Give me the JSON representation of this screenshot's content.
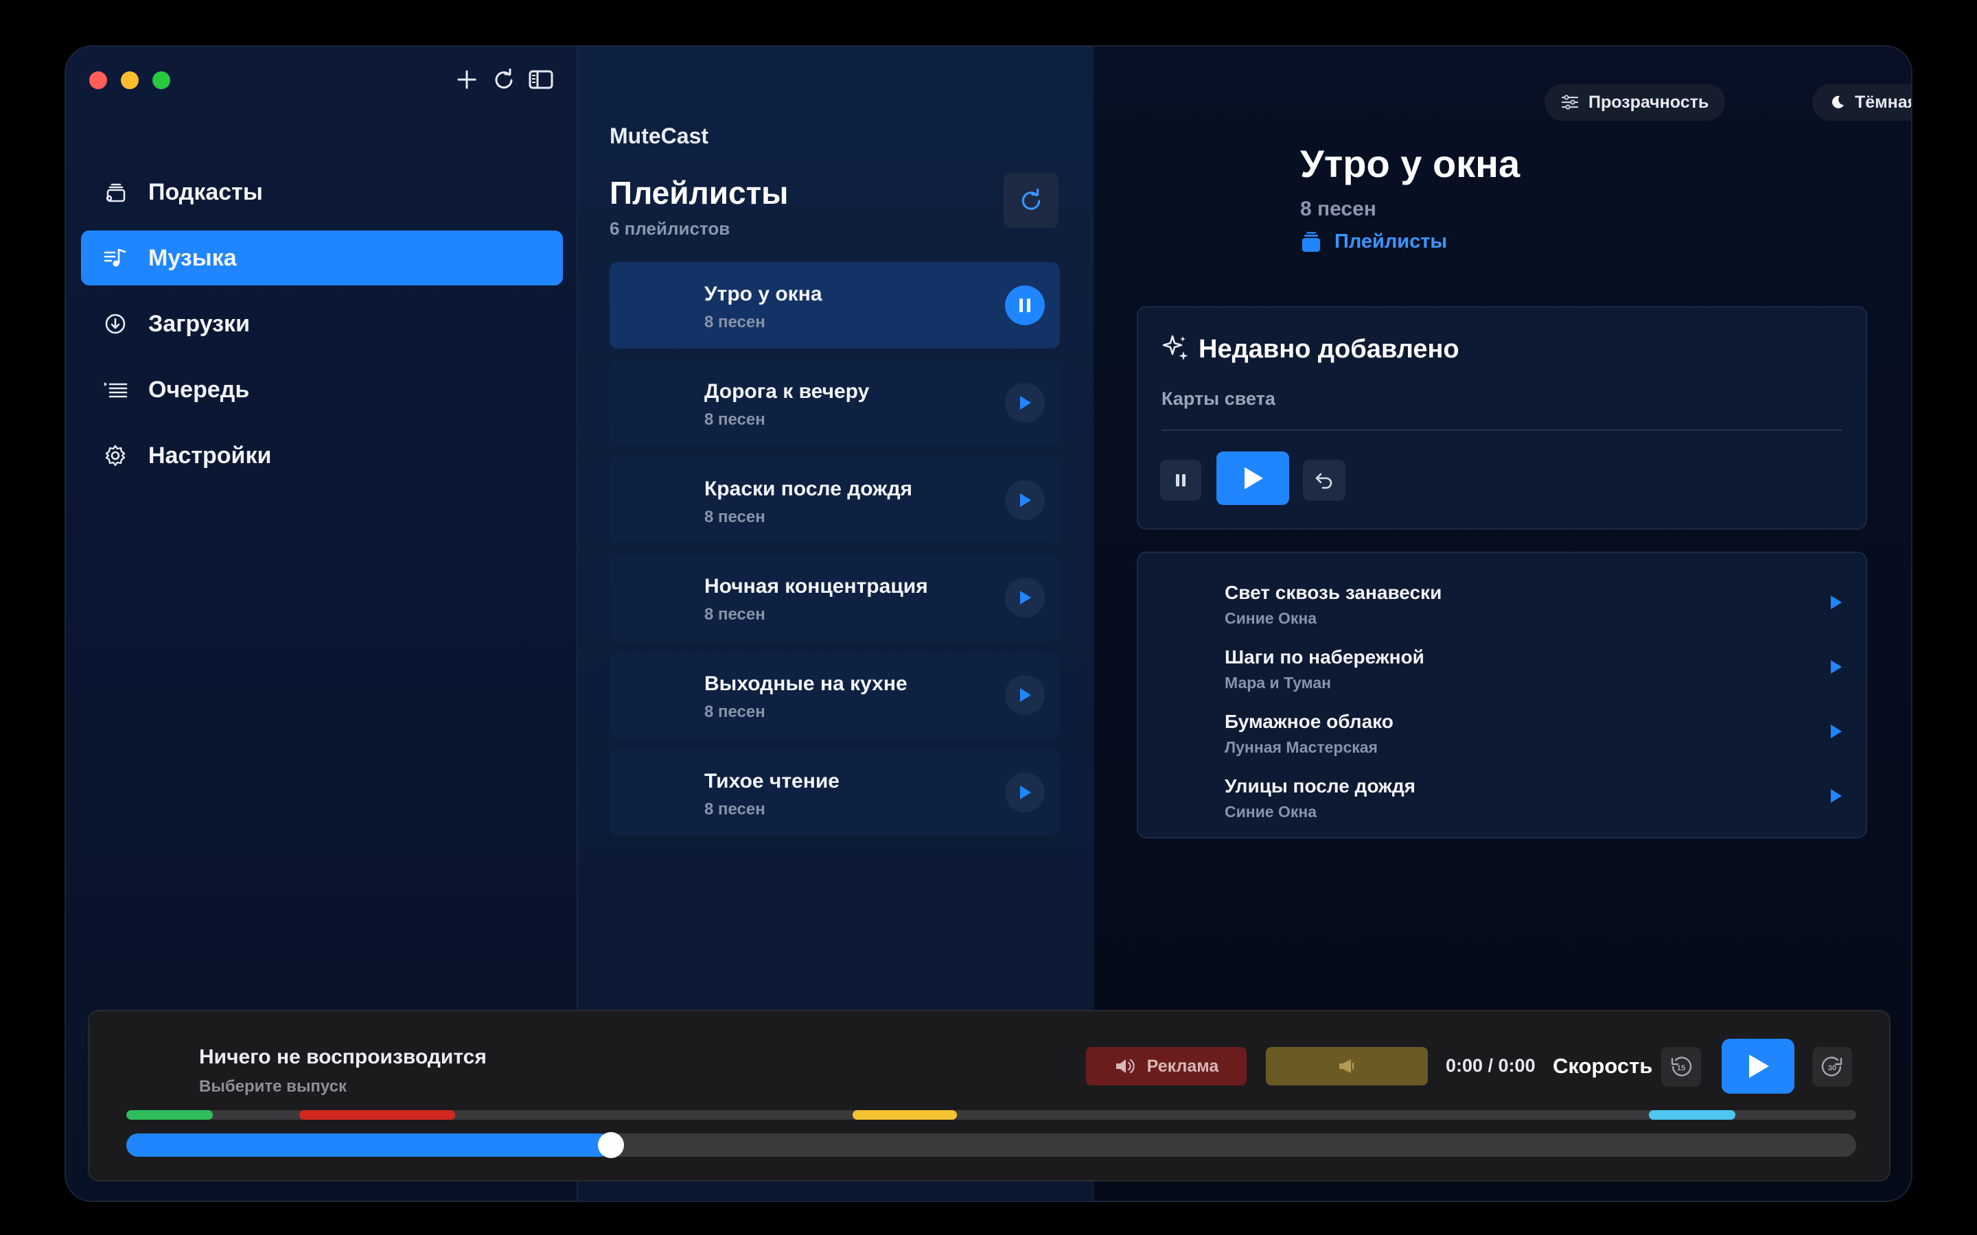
{
  "colors": {
    "accent": "#1f86ff",
    "ad_red": "#6b1d1d",
    "ad_gold": "#6b5a23",
    "chapter_green": "#2ebd59",
    "chapter_red": "#d0281f",
    "chapter_yellow": "#f2c230",
    "chapter_cyan": "#4ec6f0"
  },
  "window": {
    "toolbar": {
      "icons": [
        "plus-icon",
        "refresh-icon",
        "sidebar-toggle-icon"
      ]
    }
  },
  "sidebar": {
    "items": [
      {
        "label": "Подкасты",
        "icon": "podcasts-icon",
        "active": false
      },
      {
        "label": "Музыка",
        "icon": "music-icon",
        "active": true
      },
      {
        "label": "Загрузки",
        "icon": "download-icon",
        "active": false
      },
      {
        "label": "Очередь",
        "icon": "queue-icon",
        "active": false
      },
      {
        "label": "Настройки",
        "icon": "gear-icon",
        "active": false
      }
    ]
  },
  "playlists_panel": {
    "app_name": "MuteCast",
    "title": "Плейлисты",
    "subtitle": "6 плейлистов",
    "items": [
      {
        "name": "Утро у окна",
        "count": "8 песен",
        "state": "playing"
      },
      {
        "name": "Дорога к вечеру",
        "count": "8 песен",
        "state": "idle"
      },
      {
        "name": "Краски после дождя",
        "count": "8 песен",
        "state": "idle"
      },
      {
        "name": "Ночная концентрация",
        "count": "8 песен",
        "state": "idle"
      },
      {
        "name": "Выходные на кухне",
        "count": "8 песен",
        "state": "idle"
      },
      {
        "name": "Тихое чтение",
        "count": "8 песен",
        "state": "idle"
      }
    ]
  },
  "detail": {
    "transparency_label": "Прозрачность",
    "theme_label": "Тёмная",
    "title": "Утро у окна",
    "subtitle": "8 песен",
    "link_label": "Плейлисты",
    "recent": {
      "title": "Недавно добавлено",
      "subtitle": "Карты света"
    },
    "tracks": [
      {
        "title": "Свет сквозь занавески",
        "artist": "Синие Окна"
      },
      {
        "title": "Шаги по набережной",
        "artist": "Мара и Туман"
      },
      {
        "title": "Бумажное облако",
        "artist": "Лунная Мастерская"
      },
      {
        "title": "Улицы после дождя",
        "artist": "Синие Окна"
      }
    ]
  },
  "player": {
    "title": "Ничего не воспроизводится",
    "subtitle": "Выберите выпуск",
    "ad_label": "Реклама",
    "time": "0:00 / 0:00",
    "speed_label": "Скорость",
    "skip_back_label": "15",
    "skip_forward_label": "30",
    "progress_fraction": 0.28,
    "chapters": [
      {
        "start": 0.0,
        "end": 0.05,
        "color": "chapter_green"
      },
      {
        "start": 0.1,
        "end": 0.19,
        "color": "chapter_red"
      },
      {
        "start": 0.42,
        "end": 0.48,
        "color": "chapter_yellow"
      },
      {
        "start": 0.88,
        "end": 0.93,
        "color": "chapter_cyan"
      }
    ]
  }
}
